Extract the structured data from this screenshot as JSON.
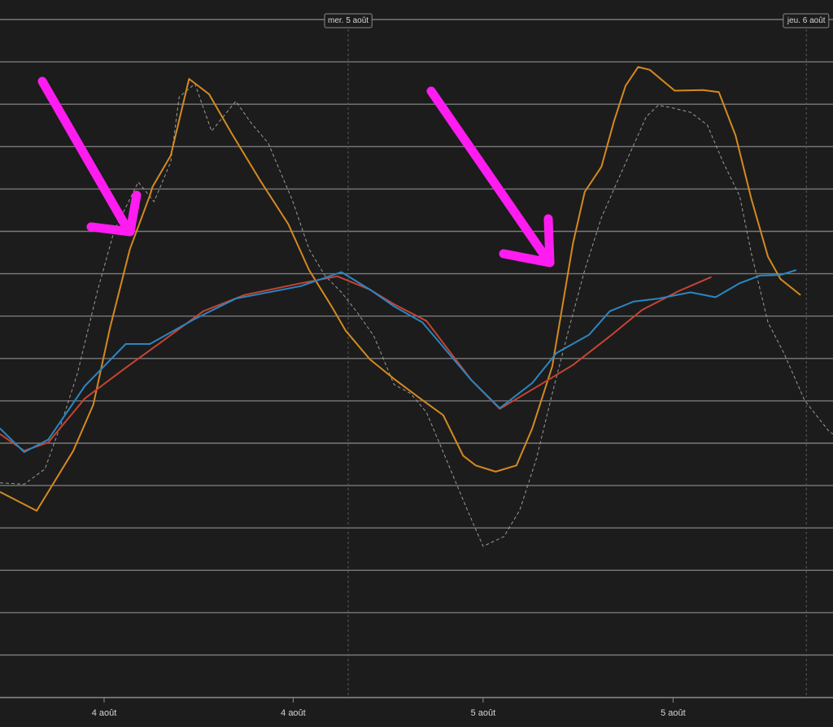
{
  "chart_data": {
    "type": "line",
    "title": "",
    "xlabel": "",
    "ylabel": "",
    "x_range": [
      0,
      100
    ],
    "y_range": [
      0,
      100
    ],
    "grid": true,
    "bottom_ticks": [
      {
        "x": 12.5,
        "label": "4 août"
      },
      {
        "x": 35.2,
        "label": "4 août"
      },
      {
        "x": 58.0,
        "label": "5 août"
      },
      {
        "x": 80.8,
        "label": "5 août"
      }
    ],
    "top_markers": [
      {
        "x": 41.8,
        "label": "mer. 5 août"
      },
      {
        "x": 96.8,
        "label": "jeu. 6 août"
      }
    ],
    "series": [
      {
        "color": "#2b86c2",
        "style": "solid",
        "points": [
          [
            0,
            38.6
          ],
          [
            2.9,
            35.2
          ],
          [
            5.8,
            37.0
          ],
          [
            10.2,
            44.7
          ],
          [
            15.1,
            50.7
          ],
          [
            18.0,
            50.7
          ],
          [
            23.4,
            54.3
          ],
          [
            28.3,
            57.2
          ],
          [
            36.1,
            59.0
          ],
          [
            41.0,
            61.0
          ],
          [
            44.4,
            58.5
          ],
          [
            47.3,
            56.1
          ],
          [
            50.7,
            53.8
          ],
          [
            56.6,
            45.5
          ],
          [
            60.0,
            41.5
          ],
          [
            63.9,
            45.1
          ],
          [
            66.8,
            49.4
          ],
          [
            70.7,
            52.0
          ],
          [
            73.2,
            55.4
          ],
          [
            76.1,
            56.8
          ],
          [
            79.0,
            57.2
          ],
          [
            82.9,
            58.1
          ],
          [
            85.9,
            57.4
          ],
          [
            88.8,
            59.4
          ],
          [
            91.2,
            60.5
          ],
          [
            93.7,
            60.6
          ],
          [
            95.6,
            61.3
          ]
        ]
      },
      {
        "color": "#c64433",
        "style": "solid",
        "points": [
          [
            0,
            37.8
          ],
          [
            2.9,
            35.4
          ],
          [
            5.8,
            36.6
          ],
          [
            10.2,
            42.9
          ],
          [
            15.1,
            47.3
          ],
          [
            19.5,
            51.1
          ],
          [
            24.4,
            55.4
          ],
          [
            29.3,
            57.7
          ],
          [
            36.1,
            59.4
          ],
          [
            40.5,
            60.4
          ],
          [
            44.4,
            58.5
          ],
          [
            47.3,
            56.4
          ],
          [
            51.2,
            54.0
          ],
          [
            56.6,
            45.5
          ],
          [
            60.0,
            41.4
          ],
          [
            64.9,
            44.9
          ],
          [
            68.8,
            47.7
          ],
          [
            73.2,
            51.8
          ],
          [
            77.1,
            55.6
          ],
          [
            81.5,
            58.3
          ],
          [
            85.4,
            60.3
          ]
        ]
      },
      {
        "color": "#d5891f",
        "style": "solid",
        "points": [
          [
            0,
            29.5
          ],
          [
            4.4,
            26.8
          ],
          [
            8.8,
            35.4
          ],
          [
            11.2,
            42.0
          ],
          [
            13.2,
            53.0
          ],
          [
            15.6,
            64.3
          ],
          [
            18.0,
            72.0
          ],
          [
            18.3,
            73.2
          ],
          [
            20.5,
            77.7
          ],
          [
            22.7,
            88.7
          ],
          [
            25.1,
            86.5
          ],
          [
            27.8,
            80.9
          ],
          [
            31.2,
            74.2
          ],
          [
            34.6,
            67.9
          ],
          [
            37.1,
            61.3
          ],
          [
            39.8,
            56.1
          ],
          [
            41.5,
            52.6
          ],
          [
            44.4,
            48.5
          ],
          [
            47.3,
            45.7
          ],
          [
            50.2,
            43.1
          ],
          [
            53.2,
            40.5
          ],
          [
            55.6,
            34.7
          ],
          [
            57.1,
            33.3
          ],
          [
            59.5,
            32.4
          ],
          [
            62.0,
            33.3
          ],
          [
            63.9,
            38.6
          ],
          [
            66.3,
            47.5
          ],
          [
            68.8,
            65.2
          ],
          [
            70.2,
            72.5
          ],
          [
            72.2,
            76.1
          ],
          [
            73.7,
            82.6
          ],
          [
            75.1,
            87.7
          ],
          [
            76.6,
            90.4
          ],
          [
            78.0,
            90.0
          ],
          [
            81.0,
            87.0
          ],
          [
            84.4,
            87.1
          ],
          [
            86.3,
            86.8
          ],
          [
            88.3,
            80.6
          ],
          [
            90.2,
            71.5
          ],
          [
            92.2,
            63.2
          ],
          [
            93.7,
            60.0
          ],
          [
            96.1,
            57.7
          ]
        ]
      },
      {
        "color": "#9a9a9a",
        "style": "dashed",
        "points": [
          [
            0,
            30.8
          ],
          [
            2.9,
            30.6
          ],
          [
            5.4,
            32.8
          ],
          [
            7.3,
            39.1
          ],
          [
            9.3,
            46.5
          ],
          [
            11.7,
            58.3
          ],
          [
            13.7,
            66.9
          ],
          [
            16.6,
            73.9
          ],
          [
            18.5,
            71.1
          ],
          [
            20.5,
            76.8
          ],
          [
            21.5,
            86.1
          ],
          [
            23.4,
            88.0
          ],
          [
            25.4,
            81.2
          ],
          [
            28.3,
            85.5
          ],
          [
            30.2,
            82.3
          ],
          [
            32.2,
            79.5
          ],
          [
            35.1,
            71.3
          ],
          [
            37.1,
            64.3
          ],
          [
            39.0,
            60.5
          ],
          [
            41.0,
            58.1
          ],
          [
            42.9,
            55.2
          ],
          [
            44.9,
            51.8
          ],
          [
            47.3,
            44.9
          ],
          [
            49.3,
            43.6
          ],
          [
            51.2,
            40.9
          ],
          [
            53.7,
            33.8
          ],
          [
            56.1,
            26.9
          ],
          [
            58.0,
            21.7
          ],
          [
            60.5,
            23.1
          ],
          [
            62.4,
            26.9
          ],
          [
            64.4,
            34.3
          ],
          [
            66.3,
            43.6
          ],
          [
            68.3,
            52.9
          ],
          [
            70.2,
            61.3
          ],
          [
            72.2,
            68.8
          ],
          [
            74.6,
            75.3
          ],
          [
            77.6,
            83.3
          ],
          [
            79.0,
            84.9
          ],
          [
            80.5,
            84.6
          ],
          [
            82.9,
            83.9
          ],
          [
            84.9,
            82.1
          ],
          [
            86.8,
            76.8
          ],
          [
            88.8,
            71.9
          ],
          [
            90.2,
            63.7
          ],
          [
            92.2,
            53.8
          ],
          [
            94.1,
            49.4
          ],
          [
            96.6,
            42.6
          ],
          [
            99.5,
            38.2
          ],
          [
            100,
            37.8
          ]
        ]
      }
    ]
  },
  "annotations": {
    "arrow_color": "#ff1cf1"
  }
}
